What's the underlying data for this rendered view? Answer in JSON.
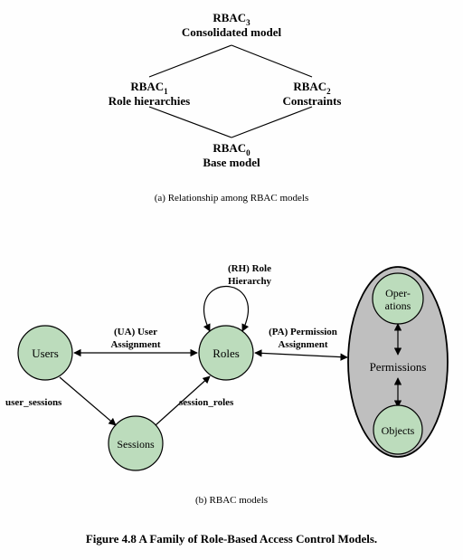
{
  "diagramA": {
    "top": {
      "main": "RBAC",
      "sub": "3",
      "desc": "Consolidated model"
    },
    "left": {
      "main": "RBAC",
      "sub": "1",
      "desc": "Role hierarchies"
    },
    "right": {
      "main": "RBAC",
      "sub": "2",
      "desc": "Constraints"
    },
    "bottom": {
      "main": "RBAC",
      "sub": "0",
      "desc": "Base model"
    },
    "caption": "(a) Relationship among RBAC models"
  },
  "diagramB": {
    "nodes": {
      "users": "Users",
      "roles": "Roles",
      "sessions": "Sessions",
      "operations1": "Oper-",
      "operations2": "ations",
      "objects": "Objects",
      "permissions": "Permissions"
    },
    "edges": {
      "rh1": "(RH) Role",
      "rh2": "Hierarchy",
      "ua1": "(UA) User",
      "ua2": "Assignment",
      "pa1": "(PA) Permission",
      "pa2": "Assignment",
      "user_sessions": "user_sessions",
      "session_roles": "session_roles"
    },
    "caption": "(b) RBAC models"
  },
  "figure_caption": "Figure 4.8   A Family of Role-Based Access Control Models."
}
